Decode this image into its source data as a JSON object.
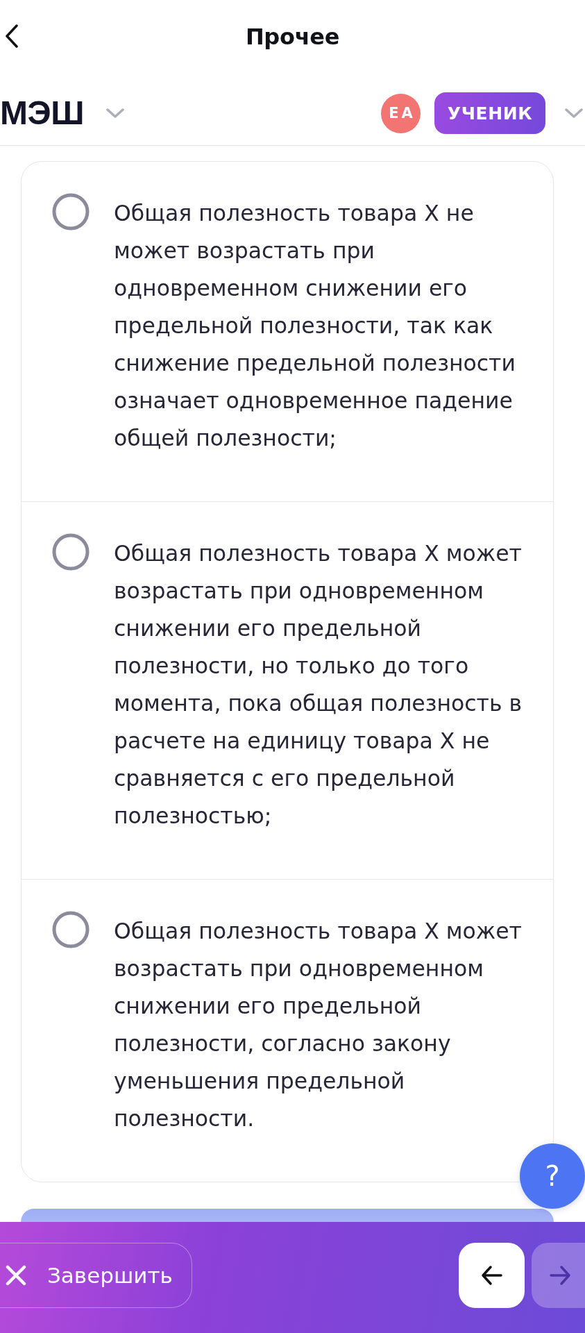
{
  "top_bar": {
    "title": "Прочее"
  },
  "header": {
    "logo": "МЭШ",
    "user": {
      "initials": "ЕА",
      "role": "УЧЕНИК"
    }
  },
  "question": {
    "options": [
      {
        "text": "Общая полезность товара Х не может возрастать при одновременном снижении его предельной полезности, так как снижение предельной полезности означает одновременное падение общей полезности;",
        "selected": false
      },
      {
        "text": "Общая полезность товара Х может возрастать при одновременном снижении его предельной полезности, но только до того момента, пока общая полезность в расчете на единицу товара Х не сравняется с его предельной полезностью;",
        "selected": false
      },
      {
        "text": "Общая полезность товара Х может возрастать при одновременном снижении его предельной полезности, согласно закону уменьшения предельной полезности.",
        "selected": false
      }
    ]
  },
  "help_button": {
    "label": "?"
  },
  "footer": {
    "finish_label": "Завершить",
    "nav_buttons": [
      {
        "kind": "back",
        "disabled": false
      },
      {
        "kind": "next",
        "disabled": true
      }
    ]
  }
}
